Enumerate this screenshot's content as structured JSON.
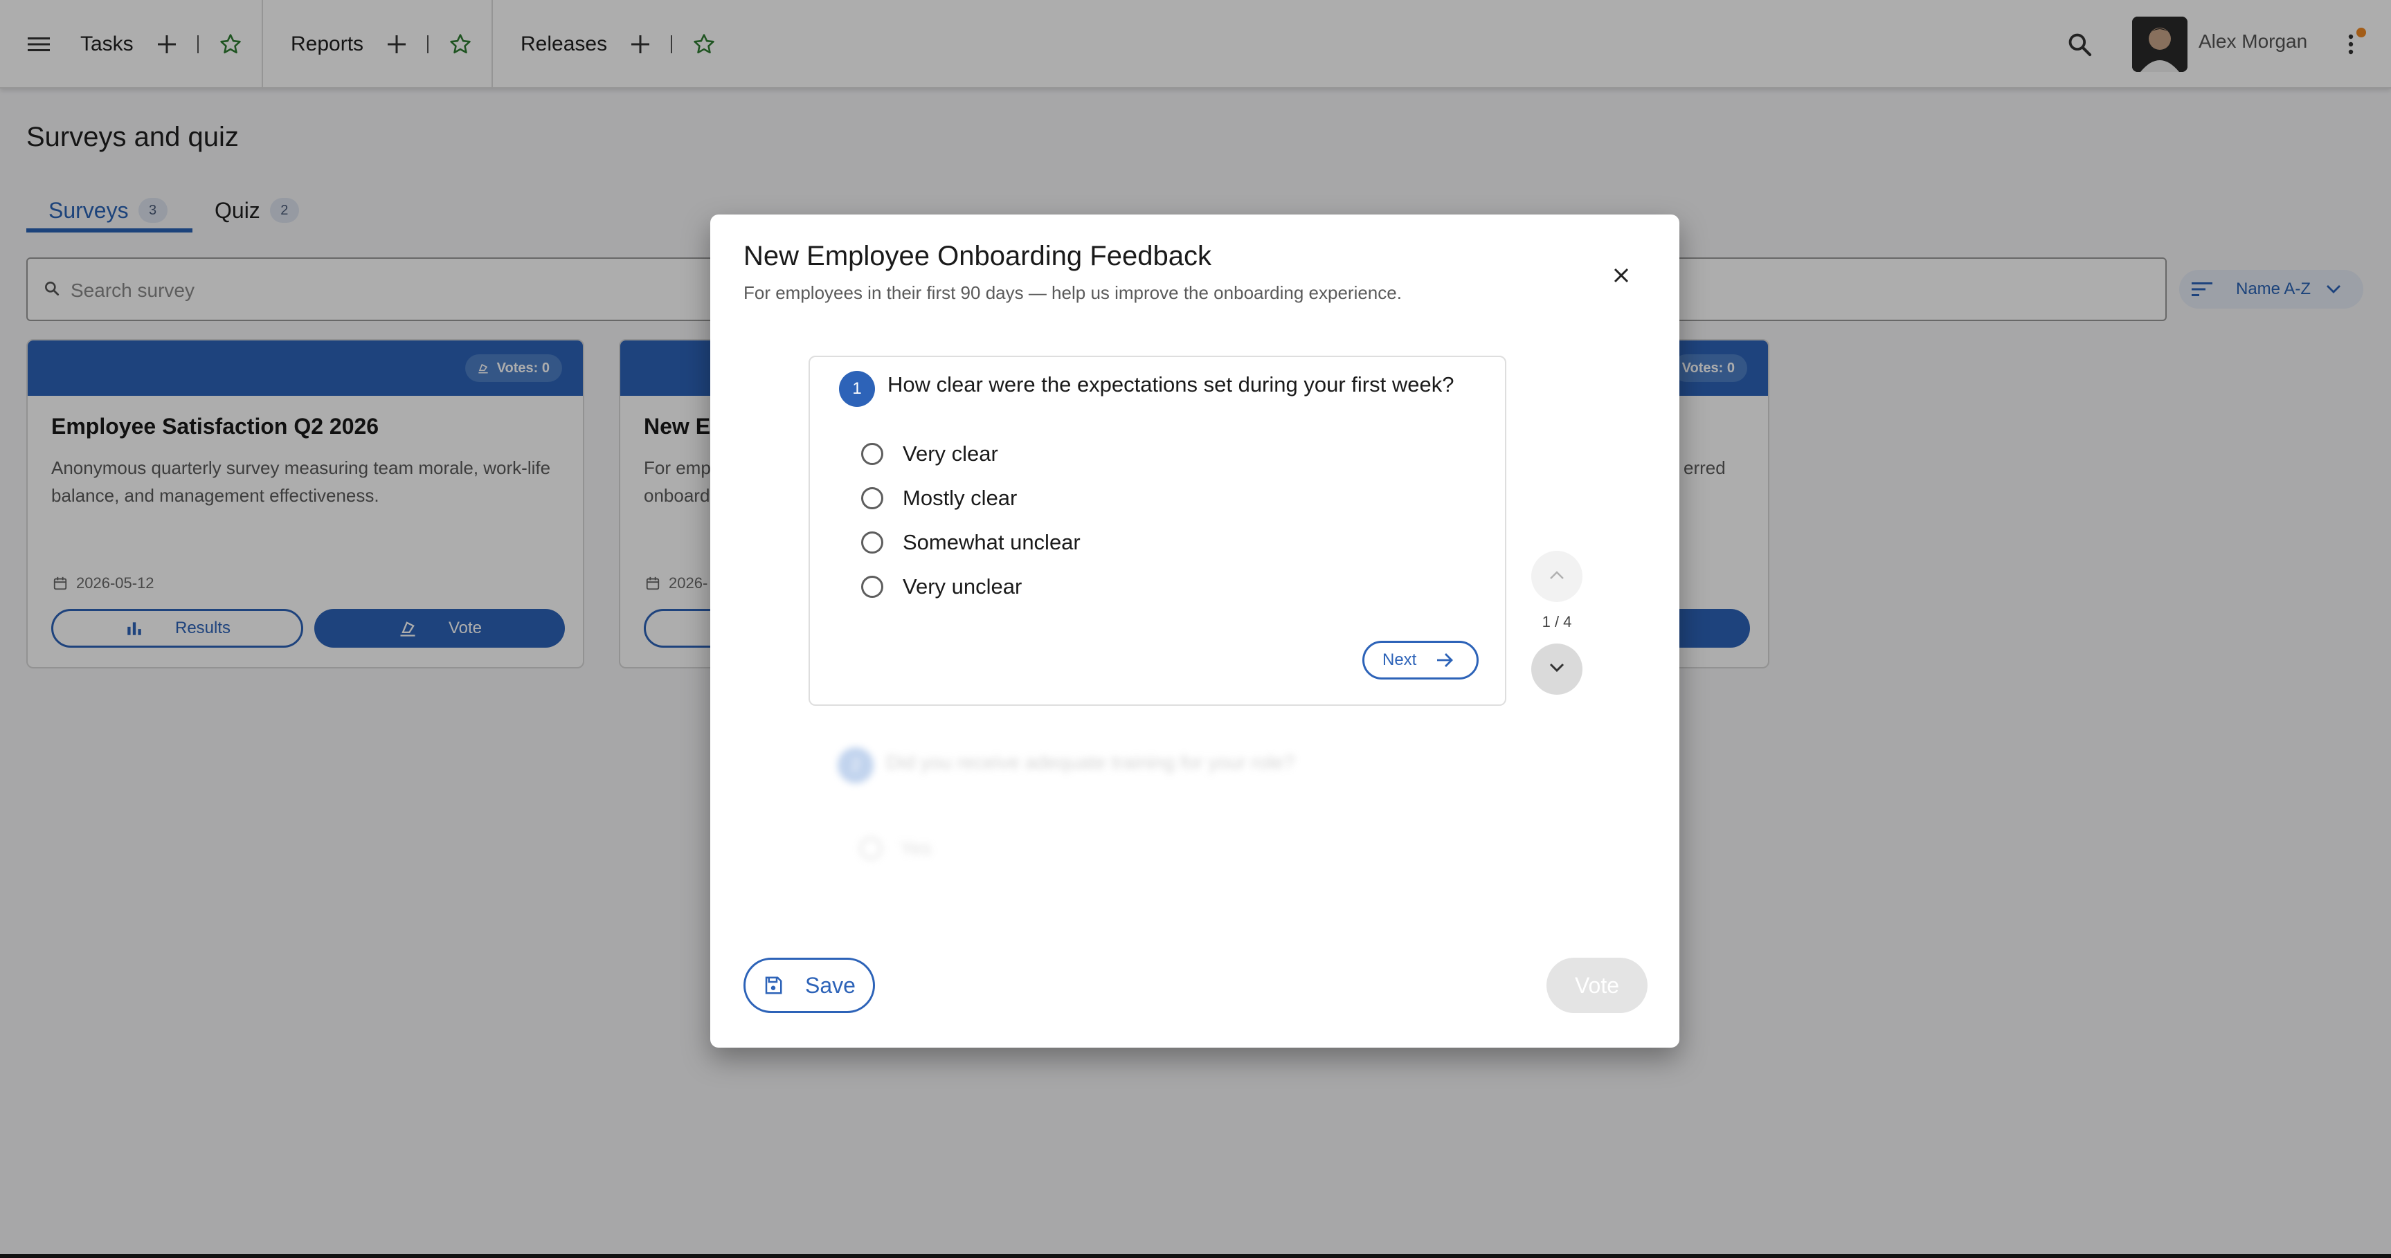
{
  "topbar": {
    "tabs": [
      {
        "label": "Tasks"
      },
      {
        "label": "Reports"
      },
      {
        "label": "Releases"
      }
    ],
    "user_name": "Alex Morgan"
  },
  "page": {
    "title": "Surveys and quiz",
    "tabs": [
      {
        "label": "Surveys",
        "count": "3",
        "active": true
      },
      {
        "label": "Quiz",
        "count": "2",
        "active": false
      }
    ],
    "search_placeholder": "Search survey",
    "sort_label": "Name A-Z"
  },
  "cards": [
    {
      "title": "Employee Satisfaction Q2 2026",
      "description": "Anonymous quarterly survey measuring team morale, work-life balance, and management effectiveness.",
      "votes": "Votes: 0",
      "date": "2026-05-12",
      "results_label": "Results",
      "vote_label": "Vote"
    },
    {
      "title_partial": "New Em",
      "description_partial_1": "For emp",
      "description_partial_2": "onboard",
      "date_partial": "2026-"
    },
    {
      "votes": "Votes: 0",
      "description_partial": "erred"
    }
  ],
  "modal": {
    "title": "New Employee Onboarding Feedback",
    "subtitle": "For employees in their first 90 days — help us improve the onboarding experience.",
    "question": {
      "number": "1",
      "text": "How clear were the expectations set during your first week?",
      "options": [
        "Very clear",
        "Mostly clear",
        "Somewhat unclear",
        "Very unclear"
      ],
      "next_label": "Next"
    },
    "next_question": {
      "number": "2",
      "text": "Did you receive adequate training for your role?",
      "options": [
        "Yes"
      ]
    },
    "position": "1 / 4",
    "save_label": "Save",
    "vote_label": "Vote"
  },
  "colors": {
    "primary": "#2d63b8",
    "accent_star": "#2e7d32",
    "notification": "#f08a24"
  }
}
